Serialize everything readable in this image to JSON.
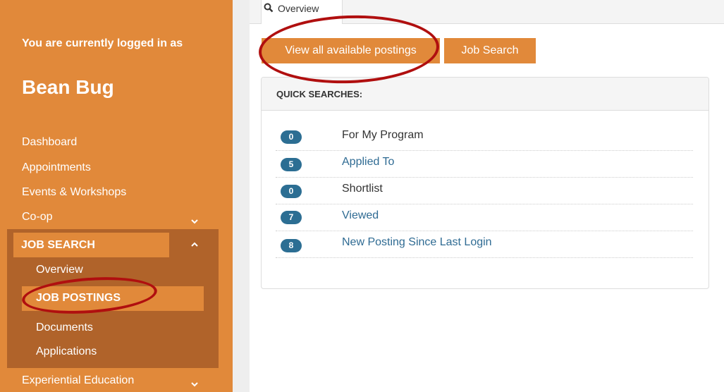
{
  "sidebar": {
    "logged_in_label": "You are currently logged in as",
    "user_name": "Bean Bug",
    "nav": [
      {
        "label": "Dashboard"
      },
      {
        "label": "Appointments"
      },
      {
        "label": "Events & Workshops"
      },
      {
        "label": "Co-op"
      }
    ],
    "job_search": {
      "label": "JOB SEARCH",
      "items": [
        {
          "label": "Overview"
        },
        {
          "label": "JOB POSTINGS",
          "active": true
        },
        {
          "label": "Documents"
        },
        {
          "label": "Applications"
        }
      ]
    },
    "experiential": {
      "label": "Experiential Education"
    }
  },
  "tabs": [
    {
      "label": "Overview",
      "icon": "search-icon"
    }
  ],
  "buttons": {
    "view_all": "View all available postings",
    "job_search": "Job Search"
  },
  "quick_searches": {
    "title": "QUICK SEARCHES:",
    "items": [
      {
        "count": "0",
        "label": "For My Program"
      },
      {
        "count": "5",
        "label": "Applied To"
      },
      {
        "count": "0",
        "label": "Shortlist"
      },
      {
        "count": "7",
        "label": "Viewed"
      },
      {
        "count": "8",
        "label": "New Posting Since Last Login"
      }
    ]
  },
  "colors": {
    "sidebar_bg": "#e1893a",
    "submenu_bg": "#b0632a",
    "badge": "#2c6e93",
    "link": "#2f6b93",
    "annotation": "#b00f0f"
  }
}
